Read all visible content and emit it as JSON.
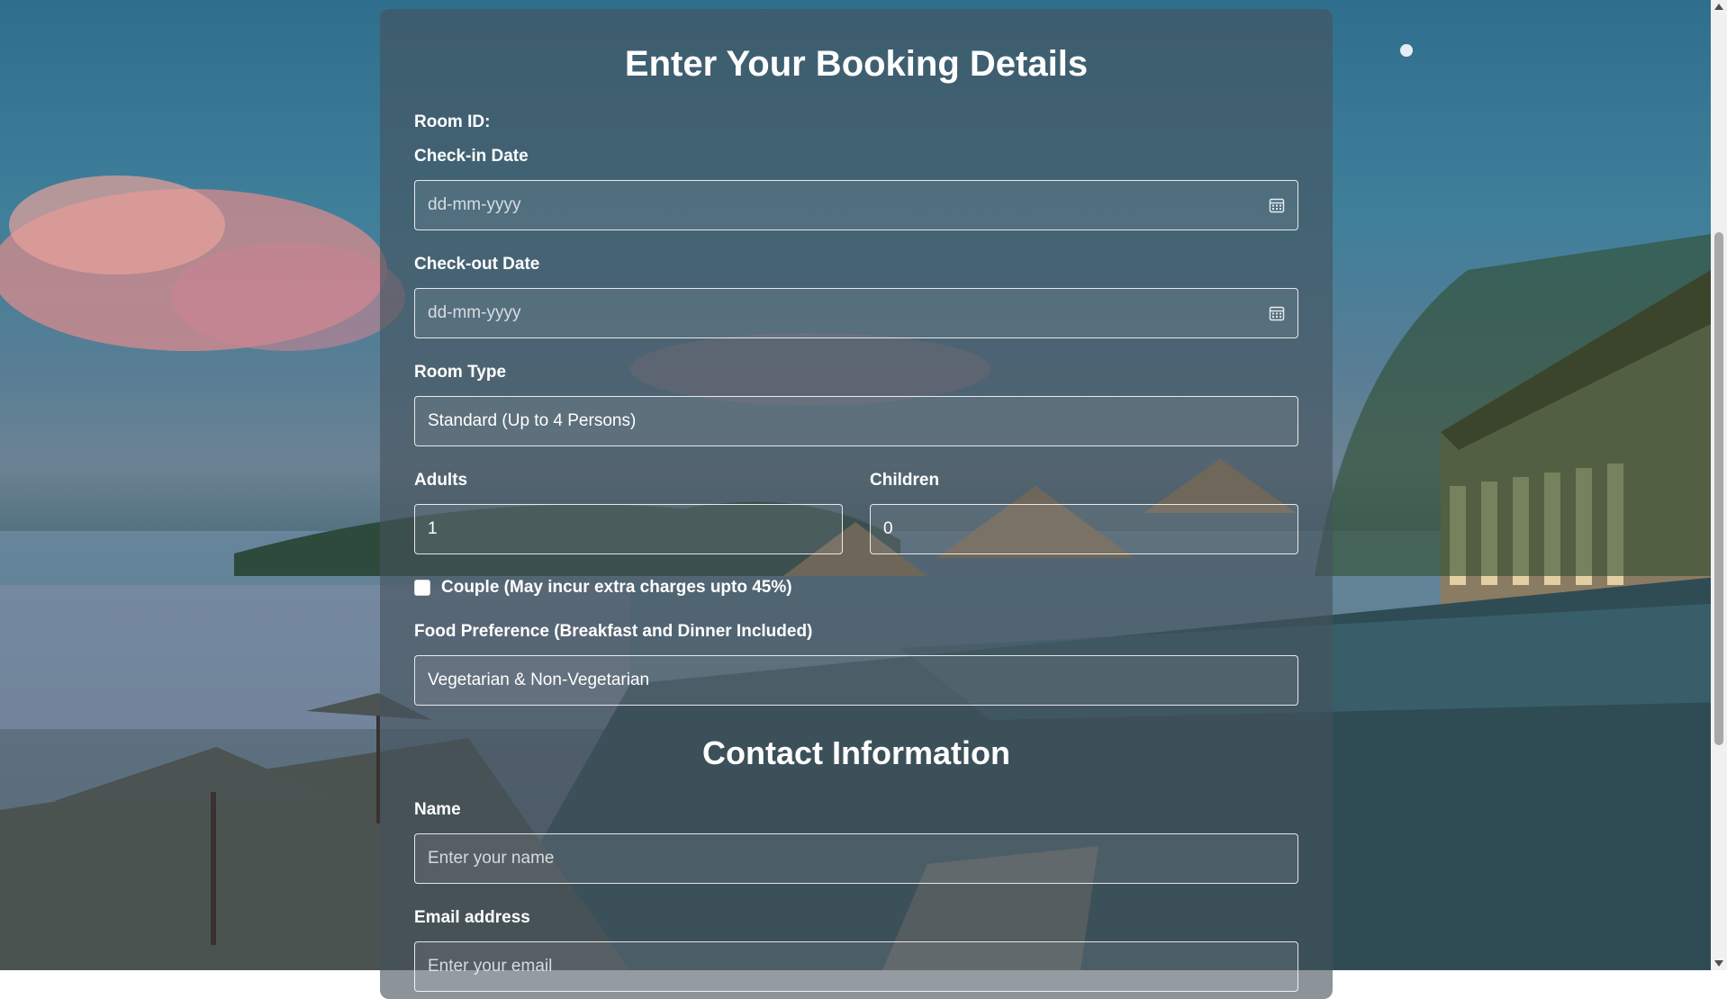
{
  "form": {
    "title": "Enter Your Booking Details",
    "room_id_label": "Room ID:",
    "checkin_label": "Check-in Date",
    "checkin_placeholder": "dd-mm-yyyy",
    "checkout_label": "Check-out Date",
    "checkout_placeholder": "dd-mm-yyyy",
    "room_type_label": "Room Type",
    "room_type_value": "Standard (Up to 4 Persons)",
    "adults_label": "Adults",
    "adults_value": "1",
    "children_label": "Children",
    "children_value": "0",
    "couple_label": "Couple (May incur extra charges upto 45%)",
    "couple_checked": false,
    "food_label": "Food Preference (Breakfast and Dinner Included)",
    "food_value": "Vegetarian & Non-Vegetarian"
  },
  "contact": {
    "title": "Contact Information",
    "name_label": "Name",
    "name_placeholder": "Enter your name",
    "email_label": "Email address",
    "email_placeholder": "Enter your email"
  },
  "icons": {
    "date_picker": "calendar-icon"
  },
  "colors": {
    "card_background": "#46525c",
    "text": "#ffffff"
  }
}
